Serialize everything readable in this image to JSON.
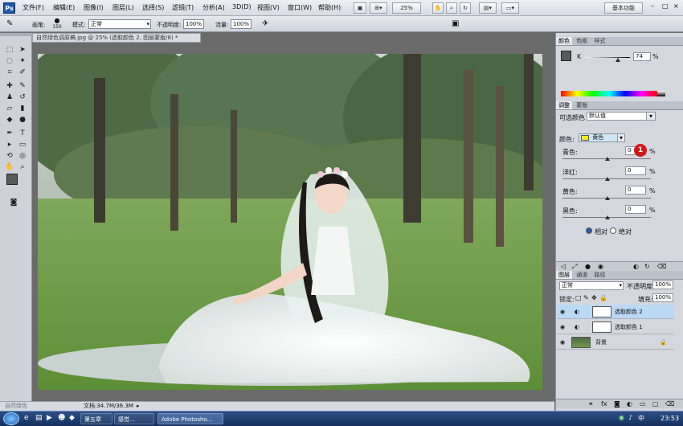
{
  "menubar": {
    "logo": "Ps",
    "items": [
      "文件(F)",
      "编辑(E)",
      "图像(I)",
      "图层(L)",
      "选择(S)",
      "滤镜(T)",
      "分析(A)",
      "3D(D)",
      "视图(V)",
      "窗口(W)",
      "帮助(H)"
    ],
    "zoom": "25%",
    "workspace": "基本功能",
    "window_controls": [
      "–",
      "□",
      "×"
    ]
  },
  "options": {
    "brush_label": "画笔:",
    "brush_size": "150",
    "mode_label": "模式:",
    "mode_value": "正常",
    "opacity_label": "不透明度:",
    "opacity_value": "100%",
    "flow_label": "流量:",
    "flow_value": "100%"
  },
  "document": {
    "tab_title": "自然绿色调原稿.jpg @ 25% (选取颜色 2, 图层蒙版/8) *",
    "status_doc": "文档:34.7M/36.3M",
    "status_left": "自然绿色"
  },
  "color_panel": {
    "tabs": [
      "颜色",
      "色板",
      "样式"
    ],
    "channel_label": "K",
    "channel_value": "74",
    "channel_level": 0.74,
    "unit": "%"
  },
  "adjust_panel": {
    "tabs": [
      "调整",
      "蒙版"
    ],
    "title": "可选颜色",
    "preset": "默认值",
    "colors_label": "颜色:",
    "colors_value": "黄色",
    "swatch_color": "#f2ea2c",
    "sliders": [
      {
        "label": "青色:",
        "value": "0",
        "unit": "%"
      },
      {
        "label": "洋红:",
        "value": "0",
        "unit": "%"
      },
      {
        "label": "黄色:",
        "value": "0",
        "unit": "%"
      },
      {
        "label": "黑色:",
        "value": "0",
        "unit": "%"
      }
    ],
    "method_relative": "相对",
    "method_absolute": "绝对",
    "cursor_badge": "1"
  },
  "layers_panel": {
    "tabs": [
      "图层",
      "通道",
      "路径"
    ],
    "blend_mode": "正常",
    "opacity_label": "不透明度:",
    "opacity_value": "100%",
    "lock_label": "锁定:",
    "fill_label": "填充:",
    "fill_value": "100%",
    "layers": [
      {
        "name": "选取颜色 2",
        "selected": true
      },
      {
        "name": "选取颜色 1",
        "selected": false
      },
      {
        "name": "背景",
        "selected": false
      }
    ]
  },
  "taskbar": {
    "items": [
      "第五章",
      "感觉...",
      "Adobe Photosho..."
    ],
    "time": "23:53"
  }
}
